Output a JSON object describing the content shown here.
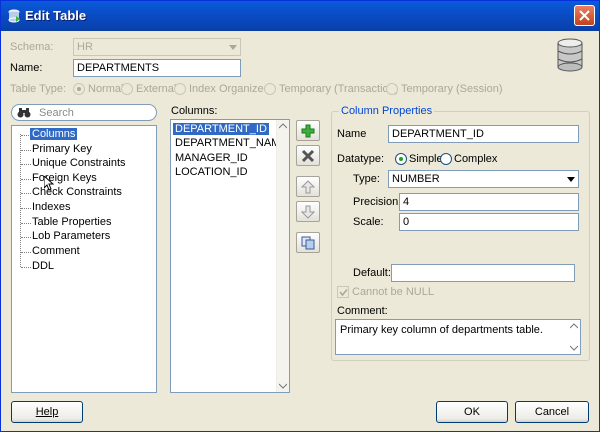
{
  "window": {
    "title": "Edit Table"
  },
  "schema": {
    "label": "Schema:",
    "value": "HR"
  },
  "name": {
    "label": "Name:",
    "value": "DEPARTMENTS"
  },
  "table_type": {
    "label": "Table Type:",
    "options": [
      "Normal",
      "External",
      "Index Organized",
      "Temporary (Transaction)",
      "Temporary (Session)"
    ],
    "selected": "Normal"
  },
  "search": {
    "placeholder": "Search"
  },
  "nav": {
    "items": [
      "Columns",
      "Primary Key",
      "Unique Constraints",
      "Foreign Keys",
      "Check Constraints",
      "Indexes",
      "Table Properties",
      "Lob Parameters",
      "Comment",
      "DDL"
    ],
    "selected": "Columns"
  },
  "columns": {
    "label": "Columns:",
    "items": [
      "DEPARTMENT_ID",
      "DEPARTMENT_NAME",
      "MANAGER_ID",
      "LOCATION_ID"
    ],
    "selected": "DEPARTMENT_ID"
  },
  "toolbar": {
    "icons": [
      "add-icon",
      "remove-icon",
      "move-up-icon",
      "move-down-icon",
      "copy-icon"
    ]
  },
  "props": {
    "title": "Column Properties",
    "name_label": "Name",
    "name_value": "DEPARTMENT_ID",
    "datatype_label": "Datatype:",
    "datatype_options": [
      "Simple",
      "Complex"
    ],
    "datatype_selected": "Simple",
    "type_label": "Type:",
    "type_value": "NUMBER",
    "precision_label": "Precision:",
    "precision_value": "4",
    "scale_label": "Scale:",
    "scale_value": "0",
    "default_label": "Default:",
    "default_value": "",
    "not_null_label": "Cannot be NULL",
    "not_null_checked": true,
    "comment_label": "Comment:",
    "comment_value": "Primary key column of departments table."
  },
  "buttons": {
    "help": "Help",
    "ok": "OK",
    "cancel": "Cancel"
  },
  "colors": {
    "title_bar": "#0A4CC4",
    "selection": "#316AC5",
    "background": "#ECE9D8",
    "group_title": "#0046D5"
  }
}
